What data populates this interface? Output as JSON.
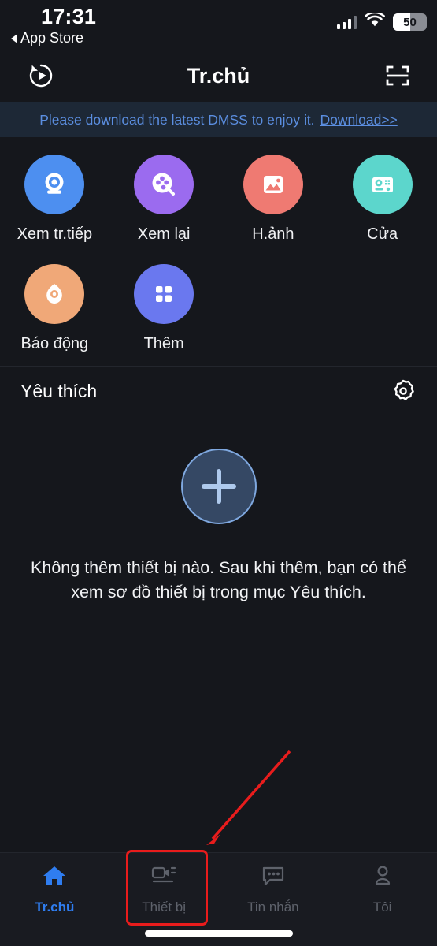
{
  "status_bar": {
    "time": "17:31",
    "back_label": "App Store",
    "battery_level": "50",
    "signal_icon": "signal-bars-icon",
    "wifi_icon": "wifi-icon",
    "battery_icon": "battery-icon"
  },
  "nav": {
    "title": "Tr.chủ",
    "left_icon": "replay-history-icon",
    "right_icon": "qr-scan-icon"
  },
  "banner": {
    "text": "Please download the latest DMSS to enjoy it.",
    "link_label": "Download>>",
    "background": "#1d2836",
    "text_color": "#5b8ee0"
  },
  "shortcuts": [
    {
      "label": "Xem tr.tiếp",
      "icon": "live-camera-icon",
      "color": "#4d8ff0"
    },
    {
      "label": "Xem lại",
      "icon": "playback-film-reel-icon",
      "color": "#9b6bef"
    },
    {
      "label": "H.ảnh",
      "icon": "picture-image-icon",
      "color": "#ef7a72"
    },
    {
      "label": "Cửa",
      "icon": "door-station-icon",
      "color": "#5cd6cc"
    },
    {
      "label": "Báo động",
      "icon": "alarm-siren-icon",
      "color": "#f0a878"
    },
    {
      "label": "Thêm",
      "icon": "more-grid-icon",
      "color": "#6a78ef"
    }
  ],
  "favorites": {
    "title": "Yêu thích",
    "gear_icon": "gear-icon",
    "add_icon": "plus-icon",
    "empty_text": "Không thêm thiết bị nào. Sau khi thêm, bạn có thể xem sơ đồ thiết bị trong mục Yêu thích."
  },
  "tabbar": {
    "items": [
      {
        "label": "Tr.chủ",
        "icon": "home-icon",
        "active": true
      },
      {
        "label": "Thiết bị",
        "icon": "device-camera-icon",
        "active": false
      },
      {
        "label": "Tin nhắn",
        "icon": "message-bubble-icon",
        "active": false
      },
      {
        "label": "Tôi",
        "icon": "person-profile-icon",
        "active": false
      }
    ],
    "active_color": "#2f7df0",
    "inactive_color": "#5e626b"
  },
  "annotations": {
    "highlight_color": "#e81c1c",
    "highlight_target": "Thiết bị"
  }
}
